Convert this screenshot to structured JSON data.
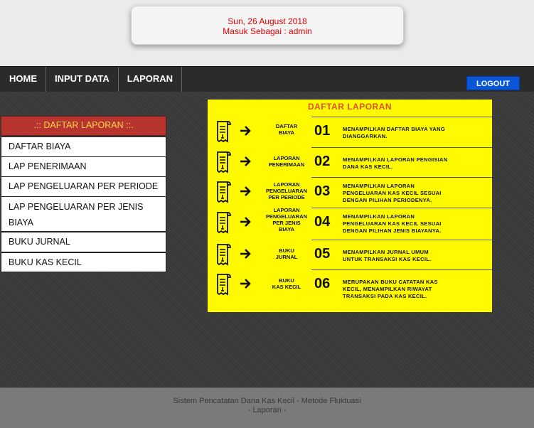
{
  "header": {
    "date": "Sun, 26 August 2018",
    "login_info": "Masuk Sebagai : admin"
  },
  "nav": {
    "items": [
      "HOME",
      "INPUT DATA",
      "LAPORAN"
    ],
    "logout": "LOGOUT"
  },
  "sidebar": {
    "title": ".:: DAFTAR LAPORAN ::.",
    "items": [
      "DAFTAR BIAYA",
      "LAP PENERIMAAN",
      "LAP PENGELUARAN PER PERIODE",
      "LAP PENGELUARAN PER JENIS BIAYA",
      "BUKU JURNAL",
      "BUKU KAS KECIL"
    ]
  },
  "panel": {
    "title": "DAFTAR LAPORAN",
    "rows": [
      {
        "label": "DAFTAR\nBIAYA",
        "num": "01",
        "desc": "MENAMPILKAN DAFTAR BIAYA YANG\nDIANGGARKAN."
      },
      {
        "label": "LAPORAN\nPENERIMAAN",
        "num": "02",
        "desc": "MENAMPILKAN LAPORAN PENGISIAN\nDANA KAS KECIL."
      },
      {
        "label": "LAPORAN\nPENGELUARAN\nPER PERIODE",
        "num": "03",
        "desc": "MENAMPILKAN LAPORAN\nPENGELUARAN KAS KECIL SESUAI\nDENGAN PILIHAN PERIODENYA."
      },
      {
        "label": "LAPORAN\nPENGELUARAN\nPER JENIS\nBIAYA",
        "num": "04",
        "desc": "MENAMPILKAN LAPORAN\nPENGELUARAN KAS KECIL SESUAI\nDENGAN PILIHAN JENIS BIAYANYA."
      },
      {
        "label": "BUKU\nJURNAL",
        "num": "05",
        "desc": "MENAMPILKAN JURNAL UMUM\nUNTUK TRANSAKSI KAS KECIL."
      },
      {
        "label": "BUKU\nKAS KECIL",
        "num": "06",
        "desc": "MERUPAKAN BUKU CATATAN KAS\nKECIL, MENAMPILKAN RIWAYAT\nTRANSAKSI PADA KAS KECIL."
      }
    ]
  },
  "footer": {
    "line1": "Sistem Pencatatan Dana Kas Kecil - Metode Fluktuasi",
    "line2": "- Laporan -"
  }
}
